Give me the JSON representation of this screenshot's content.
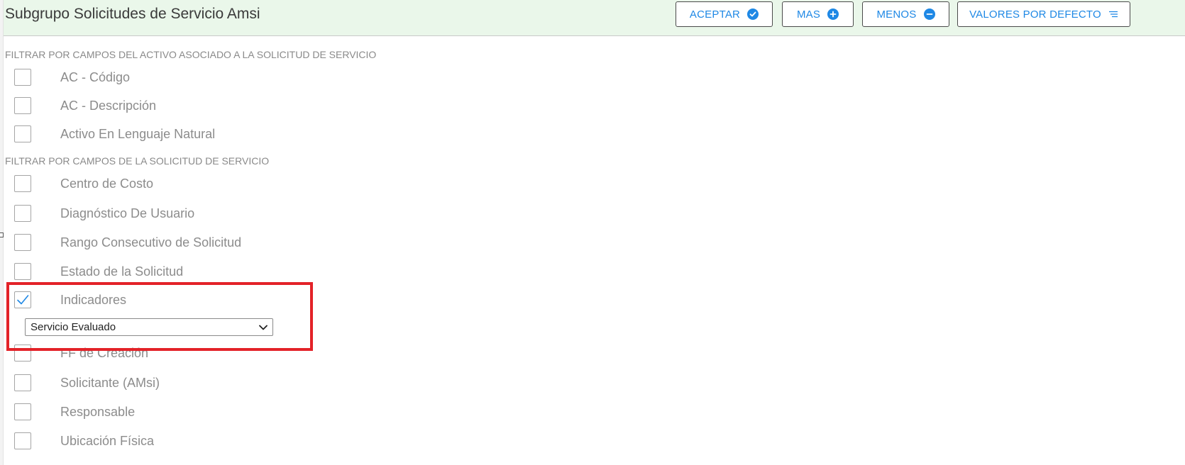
{
  "header": {
    "title": "Subgrupo Solicitudes de Servicio Amsi",
    "buttons": {
      "accept": {
        "label": "ACEPTAR",
        "icon": "check-circle-icon"
      },
      "more": {
        "label": "MAS",
        "icon": "plus-circle-icon"
      },
      "less": {
        "label": "MENOS",
        "icon": "minus-circle-icon"
      },
      "defaults": {
        "label": "VALORES POR DEFECTO",
        "icon": "sort-lines-icon"
      }
    }
  },
  "colors": {
    "accent": "#1e88e5",
    "header_bg": "#eaf7ea",
    "highlight": "#e32228"
  },
  "sections": {
    "asset": {
      "title": "FILTRAR POR CAMPOS DEL ACTIVO ASOCIADO A LA SOLICITUD DE SERVICIO",
      "fields": [
        {
          "label": "AC - Código",
          "checked": false
        },
        {
          "label": "AC - Descripción",
          "checked": false
        },
        {
          "label": "Activo En Lenguaje Natural",
          "checked": false
        }
      ]
    },
    "request": {
      "title": "FILTRAR POR CAMPOS DE LA SOLICITUD DE SERVICIO",
      "fields": [
        {
          "label": "Centro de Costo",
          "checked": false
        },
        {
          "label": "Diagnóstico De Usuario",
          "checked": false
        },
        {
          "label": "Rango Consecutivo de Solicitud",
          "checked": false
        },
        {
          "label": "Estado de la Solicitud",
          "checked": false
        },
        {
          "label": "Indicadores",
          "checked": true
        },
        {
          "label": "FF de Creación",
          "checked": false
        },
        {
          "label": "Solicitante (AMsi)",
          "checked": false
        },
        {
          "label": "Responsable",
          "checked": false
        },
        {
          "label": "Ubicación Física",
          "checked": false
        }
      ]
    }
  },
  "indicators_select": {
    "value": "Servicio Evaluado"
  }
}
